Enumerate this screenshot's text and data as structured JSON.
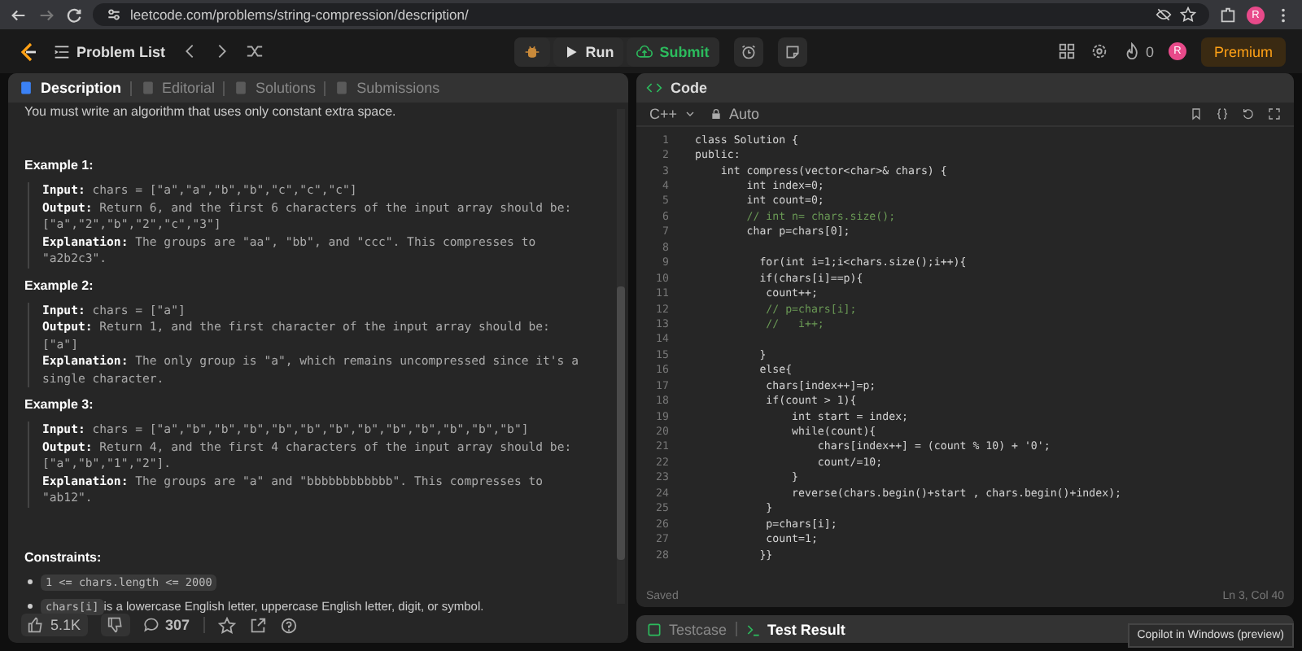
{
  "browser": {
    "url": "leetcode.com/problems/string-compression/description/",
    "avatar": "R"
  },
  "navbar": {
    "problem_list": "Problem List",
    "run": "Run",
    "submit": "Submit",
    "streak": "0",
    "avatar": "R",
    "premium": "Premium"
  },
  "left_tabs": [
    {
      "label": "Description",
      "selected": true
    },
    {
      "label": "Editorial",
      "selected": false
    },
    {
      "label": "Solutions",
      "selected": false
    },
    {
      "label": "Submissions",
      "selected": false
    }
  ],
  "description": {
    "intro": "You must write an algorithm that uses only constant extra space.",
    "examples": [
      {
        "title": "Example 1:",
        "lines": [
          "**Input:** chars = [\"a\",\"a\",\"b\",\"b\",\"c\",\"c\",\"c\"]",
          "**Output:** Return 6, and the first 6 characters of the input array should be: [\"a\",\"2\",\"b\",\"2\",\"c\",\"3\"]",
          "**Explanation:** The groups are \"aa\", \"bb\", and \"ccc\". This compresses to \"a2b2c3\"."
        ]
      },
      {
        "title": "Example 2:",
        "lines": [
          "**Input:** chars = [\"a\"]",
          "**Output:** Return 1, and the first character of the input array should be: [\"a\"]",
          "**Explanation:** The only group is \"a\", which remains uncompressed since it's a single character."
        ]
      },
      {
        "title": "Example 3:",
        "lines": [
          "**Input:** chars = [\"a\",\"b\",\"b\",\"b\",\"b\",\"b\",\"b\",\"b\",\"b\",\"b\",\"b\",\"b\",\"b\"]",
          "**Output:** Return 4, and the first 4 characters of the input array should be: [\"a\",\"b\",\"1\",\"2\"].",
          "**Explanation:** The groups are \"a\" and \"bbbbbbbbbbbb\". This compresses to \"ab12\"."
        ]
      }
    ],
    "constraints_title": "Constraints:",
    "constraints": [
      {
        "code": "1 <= chars.length <= 2000"
      },
      {
        "code": "chars[i]",
        "text": " is a lowercase English letter, uppercase English letter, digit, or symbol."
      }
    ]
  },
  "footer": {
    "likes": "5.1K",
    "comments": "307"
  },
  "code_panel": {
    "title": "Code",
    "language": "C++",
    "mode": "Auto",
    "lines": [
      {
        "n": "1",
        "kind": "code",
        "text": "class Solution {"
      },
      {
        "n": "2",
        "kind": "code",
        "text": "public:"
      },
      {
        "n": "3",
        "kind": "code",
        "text": "    int compress(vector<char>& chars) {"
      },
      {
        "n": "4",
        "kind": "code",
        "text": "        int index=0;"
      },
      {
        "n": "5",
        "kind": "code",
        "text": "        int count=0;"
      },
      {
        "n": "6",
        "kind": "comment",
        "text": "        // int n= chars.size();"
      },
      {
        "n": "7",
        "kind": "code",
        "text": "        char p=chars[0];"
      },
      {
        "n": "8"
      },
      {
        "n": "9",
        "kind": "code",
        "text": "          for(int i=1;i<chars.size();i++){"
      },
      {
        "n": "10",
        "kind": "code",
        "text": "          if(chars[i]==p){"
      },
      {
        "n": "11",
        "kind": "code",
        "text": "           count++;"
      },
      {
        "n": "12",
        "kind": "comment",
        "text": "           // p=chars[i];"
      },
      {
        "n": "13",
        "kind": "comment",
        "text": "           //   i++;"
      },
      {
        "n": "14"
      },
      {
        "n": "15",
        "kind": "code",
        "text": "          }"
      },
      {
        "n": "16",
        "kind": "code",
        "text": "          else{"
      },
      {
        "n": "17",
        "kind": "code",
        "text": "           chars[index++]=p;"
      },
      {
        "n": "18",
        "kind": "code",
        "text": "           if(count > 1){"
      },
      {
        "n": "19",
        "kind": "code",
        "text": "               int start = index;"
      },
      {
        "n": "20",
        "kind": "code",
        "text": "               while(count){"
      },
      {
        "n": "21",
        "kind": "code",
        "text": "                   chars[index++] = (count % 10) + '0';"
      },
      {
        "n": "22",
        "kind": "code",
        "text": "                   count/=10;"
      },
      {
        "n": "23",
        "kind": "code",
        "text": "               }"
      },
      {
        "n": "24",
        "kind": "code",
        "text": "               reverse(chars.begin()+start , chars.begin()+index);"
      },
      {
        "n": "25",
        "kind": "code",
        "text": "           }"
      },
      {
        "n": "26",
        "kind": "code",
        "text": "           p=chars[i];"
      },
      {
        "n": "27",
        "kind": "code",
        "text": "           count=1;"
      },
      {
        "n": "28",
        "kind": "code",
        "text": "          }}"
      }
    ],
    "status": "Saved",
    "cursor": "Ln 3, Col 40"
  },
  "bottom_tabs": [
    {
      "label": "Testcase",
      "selected": false
    },
    {
      "label": "Test Result",
      "selected": true
    }
  ],
  "tooltip": "Copilot in Windows (preview)"
}
